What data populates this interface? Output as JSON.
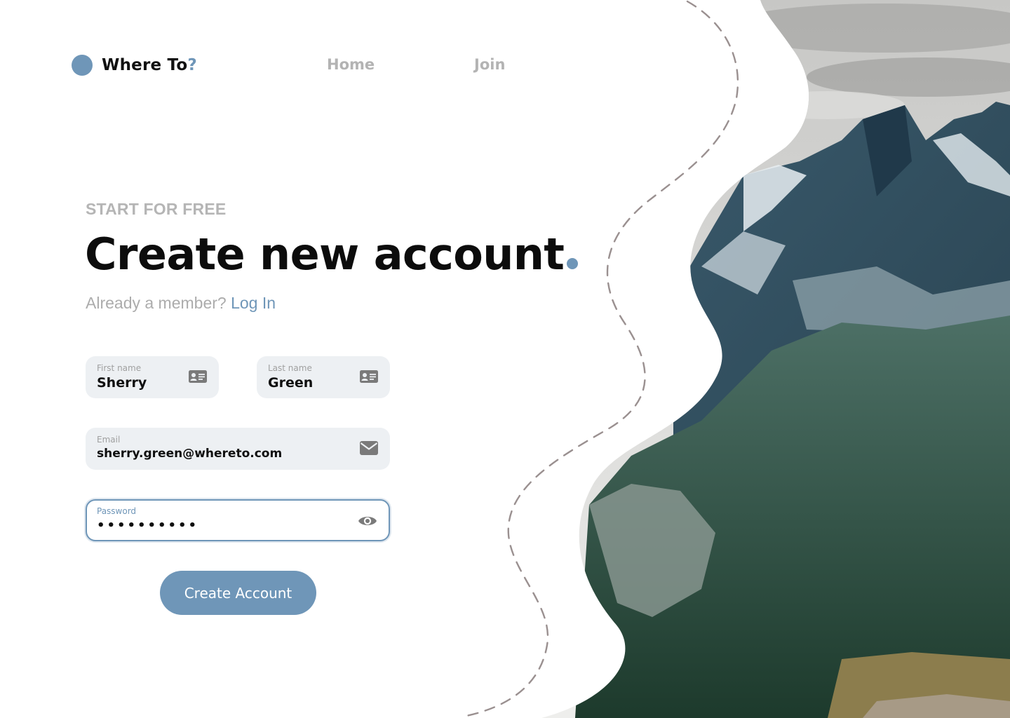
{
  "brand": {
    "name_main": "Where To",
    "name_mark": "?"
  },
  "nav": {
    "home": "Home",
    "join": "Join"
  },
  "hero": {
    "eyebrow": "START FOR FREE",
    "title": "Create new account",
    "member_prompt": "Already a member?",
    "login_link": "Log In"
  },
  "form": {
    "first_name": {
      "label": "First name",
      "value": "Sherry"
    },
    "last_name": {
      "label": "Last name",
      "value": "Green"
    },
    "email": {
      "label": "Email",
      "value": "sherry.green@whereto.com"
    },
    "password": {
      "label": "Password",
      "value": "••••••••••"
    },
    "submit_label": "Create Account"
  },
  "icons": {
    "first_name": "id-card-icon",
    "last_name": "id-card-icon",
    "email": "envelope-icon",
    "password": "eye-icon"
  },
  "colors": {
    "accent": "#6f96b8",
    "field_bg": "#edf0f3",
    "muted_text": "#b3b3b3"
  }
}
